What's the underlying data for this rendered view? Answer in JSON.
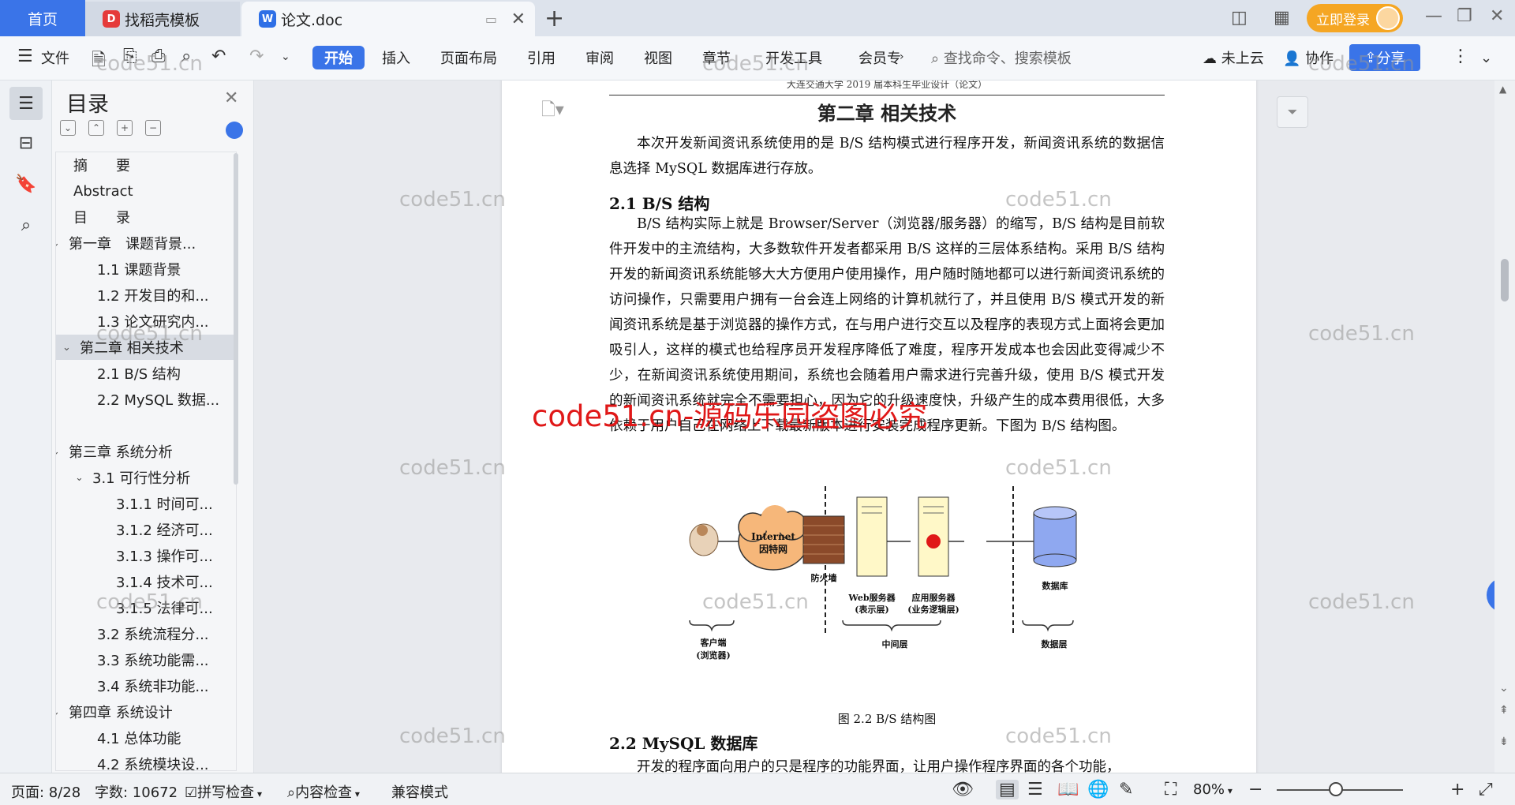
{
  "titlebar": {
    "home_tab": "首页",
    "tabs": [
      {
        "label": "找稻壳模板",
        "logo": "D"
      },
      {
        "label": "论文.doc",
        "logo": "W"
      }
    ],
    "login_label": "立即登录"
  },
  "ribbon": {
    "file_label": "文件",
    "tabs": [
      "开始",
      "插入",
      "页面布局",
      "引用",
      "审阅",
      "视图",
      "章节",
      "开发工具",
      "会员专"
    ],
    "search_placeholder": "查找命令、搜索模板",
    "cloud_label": "未上云",
    "collab_label": "协作",
    "share_label": "分享"
  },
  "toc": {
    "title": "目录",
    "items": [
      {
        "label": "摘　　要",
        "level": 1,
        "chev": ""
      },
      {
        "label": "Abstract",
        "level": 1,
        "chev": ""
      },
      {
        "label": "目　　录",
        "level": 1,
        "chev": ""
      },
      {
        "label": "第一章　课题背景...",
        "level": 1,
        "chev": "⌄"
      },
      {
        "label": "1.1 课题背景",
        "level": 2,
        "chev": ""
      },
      {
        "label": "1.2 开发目的和...",
        "level": 2,
        "chev": ""
      },
      {
        "label": "1.3 论文研究内...",
        "level": 2,
        "chev": ""
      },
      {
        "label": "第二章 相关技术",
        "level": 1,
        "chev": "⌄",
        "selected": true
      },
      {
        "label": "2.1 B/S 结构",
        "level": 2,
        "chev": ""
      },
      {
        "label": "2.2 MySQL 数据...",
        "level": 2,
        "chev": ""
      },
      {
        "label": "",
        "level": 1,
        "chev": ""
      },
      {
        "label": "第三章 系统分析",
        "level": 1,
        "chev": "⌄"
      },
      {
        "label": "3.1 可行性分析",
        "level": 2,
        "chev": "⌄"
      },
      {
        "label": "3.1.1 时间可...",
        "level": 3,
        "chev": ""
      },
      {
        "label": "3.1.2 经济可...",
        "level": 3,
        "chev": ""
      },
      {
        "label": "3.1.3 操作可...",
        "level": 3,
        "chev": ""
      },
      {
        "label": "3.1.4 技术可...",
        "level": 3,
        "chev": ""
      },
      {
        "label": "3.1.5 法律可...",
        "level": 3,
        "chev": ""
      },
      {
        "label": "3.2 系统流程分...",
        "level": 2,
        "chev": ""
      },
      {
        "label": "3.3 系统功能需...",
        "level": 2,
        "chev": ""
      },
      {
        "label": "3.4 系统非功能...",
        "level": 2,
        "chev": ""
      },
      {
        "label": "第四章 系统设计",
        "level": 1,
        "chev": "⌄"
      },
      {
        "label": "4.1 总体功能",
        "level": 2,
        "chev": ""
      },
      {
        "label": "4.2 系统模块设...",
        "level": 2,
        "chev": ""
      }
    ]
  },
  "document": {
    "header_text": "大连交通大学 2019 届本科生毕业设计（论文）",
    "chapter_title": "第二章  相关技术",
    "intro": "本次开发新闻资讯系统使用的是 B/S 结构模式进行程序开发，新闻资讯系统的数据信息选择 MySQL 数据库进行存放。",
    "section1_title": "2.1 B/S 结构",
    "section1_body": "B/S 结构实际上就是 Browser/Server（浏览器/服务器）的缩写，B/S 结构是目前软件开发中的主流结构，大多数软件开发者都采用 B/S 这样的三层体系结构。采用 B/S 结构开发的新闻资讯系统能够大大方便用户使用操作，用户随时随地都可以进行新闻资讯系统的访问操作，只需要用户拥有一台会连上网络的计算机就行了，并且使用 B/S  模式开发的新闻资讯系统是基于浏览器的操作方式，在与用户进行交互以及程序的表现方式上面将会更加吸引人，这样的模式也给程序员开发程序降低了难度，程序开发成本也会因此变得减少不少，在新闻资讯系统使用期间，系统也会随着用户需求进行完善升级，使用 B/S  模式开发的新闻资讯系统就完全不需要担心，因为它的升级速度快，升级产生的成本费用很低，大多依赖于用户自己在网络上下载最新版本进行安装完成程序更新。下图为 B/S 结构图。",
    "figure_caption": "图 2.2 B/S 结构图",
    "section2_title": "2.2 MySQL 数据库",
    "section2_body": "开发的程序面向用户的只是程序的功能界面，让用户操作程序界面的各个功能，"
  },
  "diagram": {
    "internet_label": "Internet",
    "internet_cn": "因特网",
    "firewall": "防火墙",
    "web_server": "Web服务器",
    "web_server_sub": "(表示层)",
    "app_server": "应用服务器",
    "app_server_sub": "(业务逻辑层)",
    "database": "数据库",
    "client": "客户端",
    "client_sub": "(浏览器)",
    "middle": "中间层",
    "data_layer": "数据层"
  },
  "watermark": {
    "small": "code51.cn",
    "big": "code51.cn-源码乐园盗图必究"
  },
  "status": {
    "page": "页面: 8/28",
    "words": "字数: 10672",
    "spell": "拼写检查",
    "content_check": "内容检查",
    "compat": "兼容模式",
    "zoom": "80%"
  },
  "colors": {
    "accent": "#3a74e8",
    "login": "#f5a623",
    "watermark_red": "#e01818"
  }
}
